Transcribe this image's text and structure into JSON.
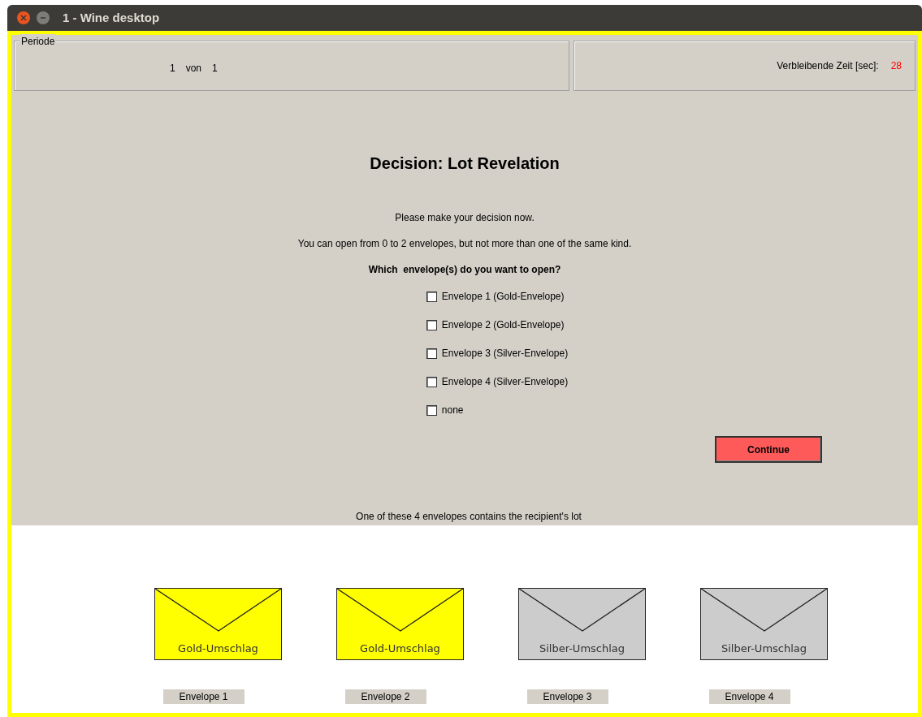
{
  "window": {
    "title": "1 - Wine desktop"
  },
  "period": {
    "legend": "Periode",
    "current": "1",
    "separator": "von",
    "total": "1"
  },
  "timer": {
    "label": "Verbleibende Zeit [sec]:",
    "value": "28"
  },
  "heading": "Decision: Lot Revelation",
  "instructions": [
    "Please make your decision now.",
    "You can open from 0 to 2 envelopes, but not more than one of the same kind."
  ],
  "question": "Which  envelope(s) do you want to open?",
  "options": [
    {
      "label": "Envelope 1 (Gold-Envelope)",
      "checked": false
    },
    {
      "label": "Envelope 2 (Gold-Envelope)",
      "checked": false
    },
    {
      "label": "Envelope 3 (Silver-Envelope)",
      "checked": false
    },
    {
      "label": "Envelope 4 (Silver-Envelope)",
      "checked": false
    },
    {
      "label": "none",
      "checked": false
    }
  ],
  "continue_button": "Continue",
  "note": "One of these 4 envelopes contains the recipient's lot",
  "envelopes": [
    {
      "text": "Gold-Umschlag",
      "caption": "Envelope 1",
      "color": "#ffff00"
    },
    {
      "text": "Gold-Umschlag",
      "caption": "Envelope 2",
      "color": "#ffff00"
    },
    {
      "text": "Silber-Umschlag",
      "caption": "Envelope 3",
      "color": "#cccccc"
    },
    {
      "text": "Silber-Umschlag",
      "caption": "Envelope 4",
      "color": "#cccccc"
    }
  ]
}
